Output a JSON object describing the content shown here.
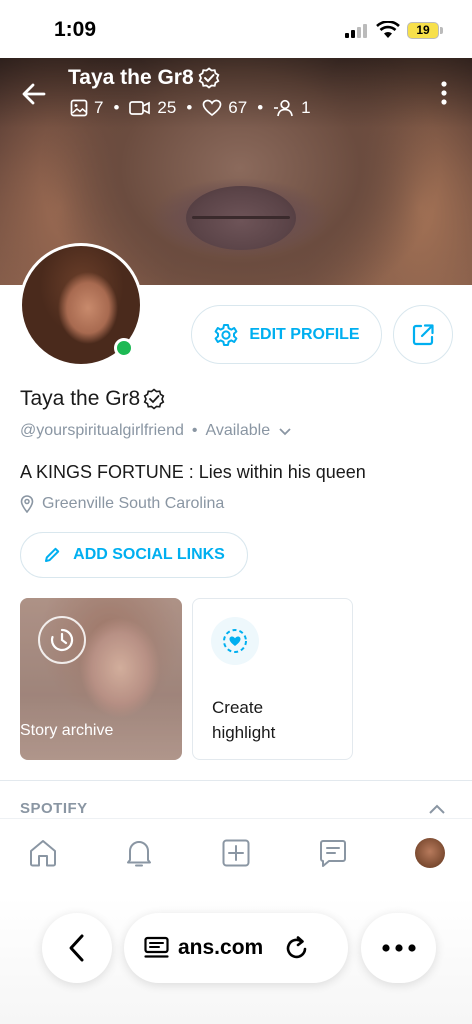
{
  "status_bar": {
    "time": "1:09",
    "battery": "19",
    "battery_color": "#f7e04b"
  },
  "header": {
    "title": "Taya the Gr8",
    "stats": {
      "photos": "7",
      "videos": "25",
      "likes": "67",
      "subscribers": "1"
    },
    "icons": [
      "back-arrow-icon",
      "verified-icon",
      "image-icon",
      "video-icon",
      "heart-icon",
      "user-icon",
      "more-vertical-icon"
    ]
  },
  "profile": {
    "name": "Taya the Gr8",
    "username": "@yourspiritualgirlfriend",
    "availability": "Available",
    "bio": "A KINGS FORTUNE : Lies within his queen",
    "location": "Greenville South Carolina",
    "online_color": "#1db954"
  },
  "actions": {
    "edit_profile": "EDIT PROFILE",
    "add_social_links": "ADD SOCIAL LINKS",
    "accent_color": "#00aff0"
  },
  "highlights": {
    "story_archive": "Story archive",
    "create_highlight": "Create highlight"
  },
  "sections": {
    "spotify": "SPOTIFY"
  },
  "tabbar": {
    "items": [
      "home-icon",
      "bell-icon",
      "plus-square-icon",
      "message-icon",
      "avatar"
    ]
  },
  "browser": {
    "url": "ans.com"
  }
}
